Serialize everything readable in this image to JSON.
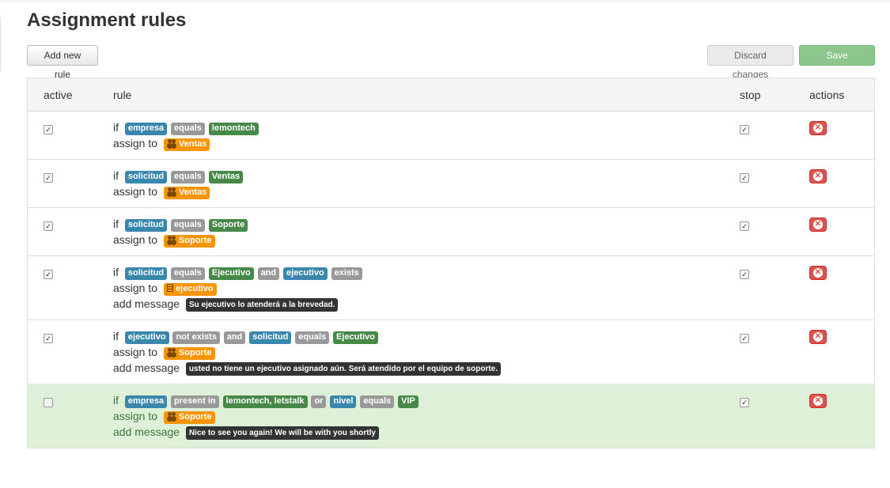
{
  "page": {
    "title": "Assignment rules"
  },
  "toolbar": {
    "add_label": "Add new rule",
    "discard_label": "Discard changes",
    "save_label": "Save changes"
  },
  "table": {
    "headers": {
      "active": "active",
      "rule": "rule",
      "stop": "stop",
      "actions": "actions"
    }
  },
  "keywords": {
    "if": "if",
    "assign_to": "assign to",
    "add_message": "add message"
  },
  "rules": [
    {
      "active": true,
      "stop": true,
      "cond": [
        "empresa",
        "equals",
        "lemontech"
      ],
      "assign": "Ventas"
    },
    {
      "active": true,
      "stop": true,
      "cond": [
        "solicitud",
        "equals",
        "Ventas"
      ],
      "assign": "Ventas"
    },
    {
      "active": true,
      "stop": true,
      "cond": [
        "solicitud",
        "equals",
        "Soporte"
      ],
      "assign": "Soporte"
    },
    {
      "active": true,
      "stop": true,
      "cond": [
        "solicitud",
        "equals",
        "Ejecutivo",
        "and",
        "ejecutivo",
        "exists"
      ],
      "assign": "ejecutivo",
      "message": "Su ejecutivo lo atenderá a la brevedad."
    },
    {
      "active": true,
      "stop": true,
      "cond": [
        "ejecutivo",
        "not exists",
        "and",
        "solicitud",
        "equals",
        "Ejecutivo"
      ],
      "assign": "Soporte",
      "message": "usted no tiene un ejecutivo asignado aún. Será atendido por el equipo de soporte."
    },
    {
      "active": false,
      "stop": true,
      "cond": [
        "empresa",
        "present in",
        "lemontech, letstalk",
        "or",
        "nivel",
        "equals",
        "VIP"
      ],
      "assign": "Soporte",
      "message": "Nice to see you again! We will be with you shortly"
    }
  ],
  "icons": {
    "user_group": "users-icon",
    "document": "document-icon",
    "delete": "remove-icon"
  },
  "colors": {
    "field": "#3a87ad",
    "operator": "#999999",
    "value": "#468847",
    "assignee": "#f89406",
    "message": "#333333",
    "delete": "#d9534f",
    "inactive_row": "#dff0d8"
  }
}
